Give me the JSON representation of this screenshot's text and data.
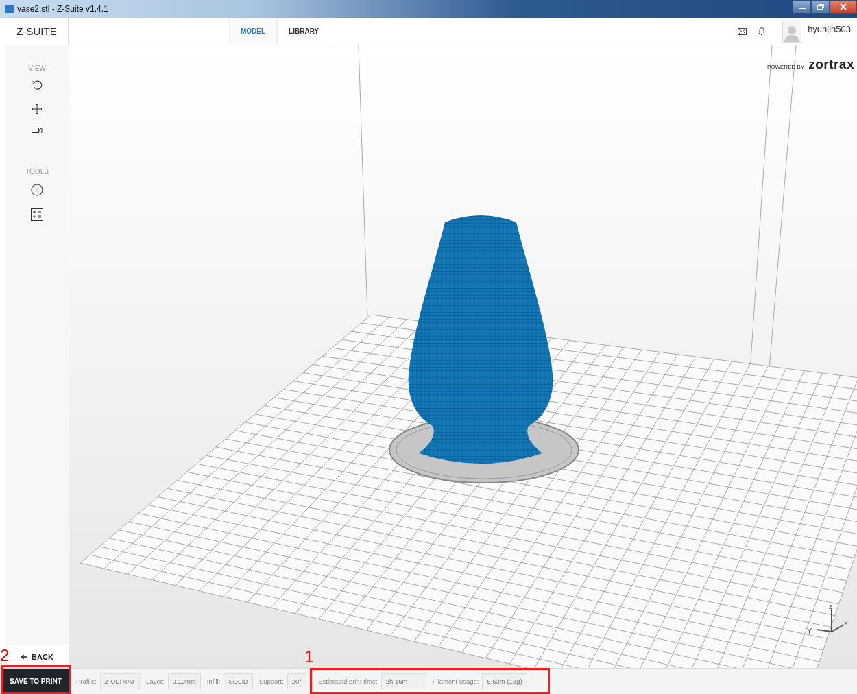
{
  "window": {
    "title": "vase2.stl - Z-Suite v1.4.1"
  },
  "header": {
    "logo": "**Z**-SUITE",
    "tabs": [
      {
        "label": "MODEL",
        "selected": true
      },
      {
        "label": "LIBRARY",
        "selected": false
      }
    ],
    "user": "hyunjin503"
  },
  "brand": {
    "prefix": "POWERED BY",
    "name": "zortrax"
  },
  "sidebar": {
    "sections": [
      {
        "title": "VIEW"
      },
      {
        "title": "TOOLS"
      }
    ],
    "back": "BACK"
  },
  "axes": [
    "Y",
    "Z",
    "X"
  ],
  "status_bar": {
    "save_button": "SAVE TO PRINT",
    "settings": [
      {
        "label": "Profile:",
        "value": "Z-ULTRAT"
      },
      {
        "label": "Layer:",
        "value": "0.19mm"
      },
      {
        "label": "Infill:",
        "value": "SOLID"
      },
      {
        "label": "Support:",
        "value": "20°"
      },
      {
        "label": "Estimated print time:",
        "value": "2h 16m"
      },
      {
        "label": "Filament usage:",
        "value": "5.63m (13g)"
      }
    ]
  },
  "annotations": [
    {
      "label": "2"
    },
    {
      "label": "1"
    }
  ]
}
